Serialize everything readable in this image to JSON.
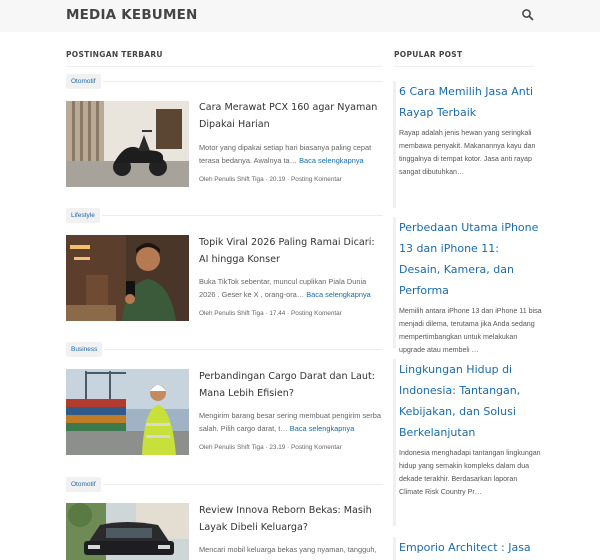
{
  "site": {
    "title": "MEDIA KEBUMEN"
  },
  "colors": {
    "accent": "#1c6aa6",
    "text": "#333333",
    "muted": "#666666"
  },
  "main": {
    "section_title": "POSTINGAN TERBARU",
    "posts": [
      {
        "label": "Otomotif",
        "title": "Cara Merawat PCX 160 agar Nyaman Dipakai Harian",
        "snippet": "Motor yang dipakai setiap hari biasanya paling cepat terasa bedanya. Awalnya ta…",
        "read_more": "Baca selengkapnya",
        "author": "Oleh Penulis Shift Tiga",
        "time": "20.19",
        "comment": "Posting Komentar",
        "thumb_icon": "scooter-image"
      },
      {
        "label": "Lifestyle",
        "title": "Topik Viral 2026 Paling Ramai Dicari: AI hingga Konser",
        "snippet": "Buka TikTok sebentar, muncul cuplikan Piala Dunia 2026 . Geser ke X , orang-ora…",
        "read_more": "Baca selengkapnya",
        "author": "Oleh Penulis Shift Tiga",
        "time": "17.44",
        "comment": "Posting Komentar",
        "thumb_icon": "man-with-phone-image"
      },
      {
        "label": "Business",
        "title": "Perbandingan Cargo Darat dan Laut: Mana Lebih Efisien?",
        "snippet": "Mengirim barang besar sering membuat pengirim serba salah. Pilih cargo darat, t…",
        "read_more": "Baca selengkapnya",
        "author": "Oleh Penulis Shift Tiga",
        "time": "23.19",
        "comment": "Posting Komentar",
        "thumb_icon": "cargo-port-image"
      },
      {
        "label": "Otomotif",
        "title": "Review Innova Reborn Bekas: Masih Layak Dibeli Keluarga?",
        "snippet": "Mencari mobil keluarga bekas yang nyaman, tangguh,",
        "read_more": "",
        "author": "",
        "time": "",
        "comment": "",
        "thumb_icon": "car-image"
      }
    ]
  },
  "sidebar": {
    "section_title": "POPULAR POST",
    "items": [
      {
        "title": "6 Cara Memilih Jasa Anti Rayap Terbaik",
        "snippet": "Rayap adalah jenis hewan yang seringkali membawa penyakit. Makanannya kayu dan tinggalnya di tempat kotor. Jasa anti rayap sangat dibutuhkan…"
      },
      {
        "title": "Perbedaan Utama iPhone 13 dan iPhone 11: Desain, Kamera, dan Performa",
        "snippet": "Memilih antara iPhone 13 dan iPhone 11 bisa menjadi dilema, terutama jika Anda sedang mempertimbangkan untuk melakukan upgrade atau membeli …"
      },
      {
        "title": "Lingkungan Hidup di Indonesia: Tantangan, Kebijakan, dan Solusi Berkelanjutan",
        "snippet": "Indonesia menghadapi tantangan lingkungan hidup yang semakin kompleks dalam dua dekade terakhir. Berdasarkan laporan Climate Risk Country Pr…"
      },
      {
        "title": "Emporio Architect : Jasa",
        "snippet": ""
      }
    ]
  }
}
